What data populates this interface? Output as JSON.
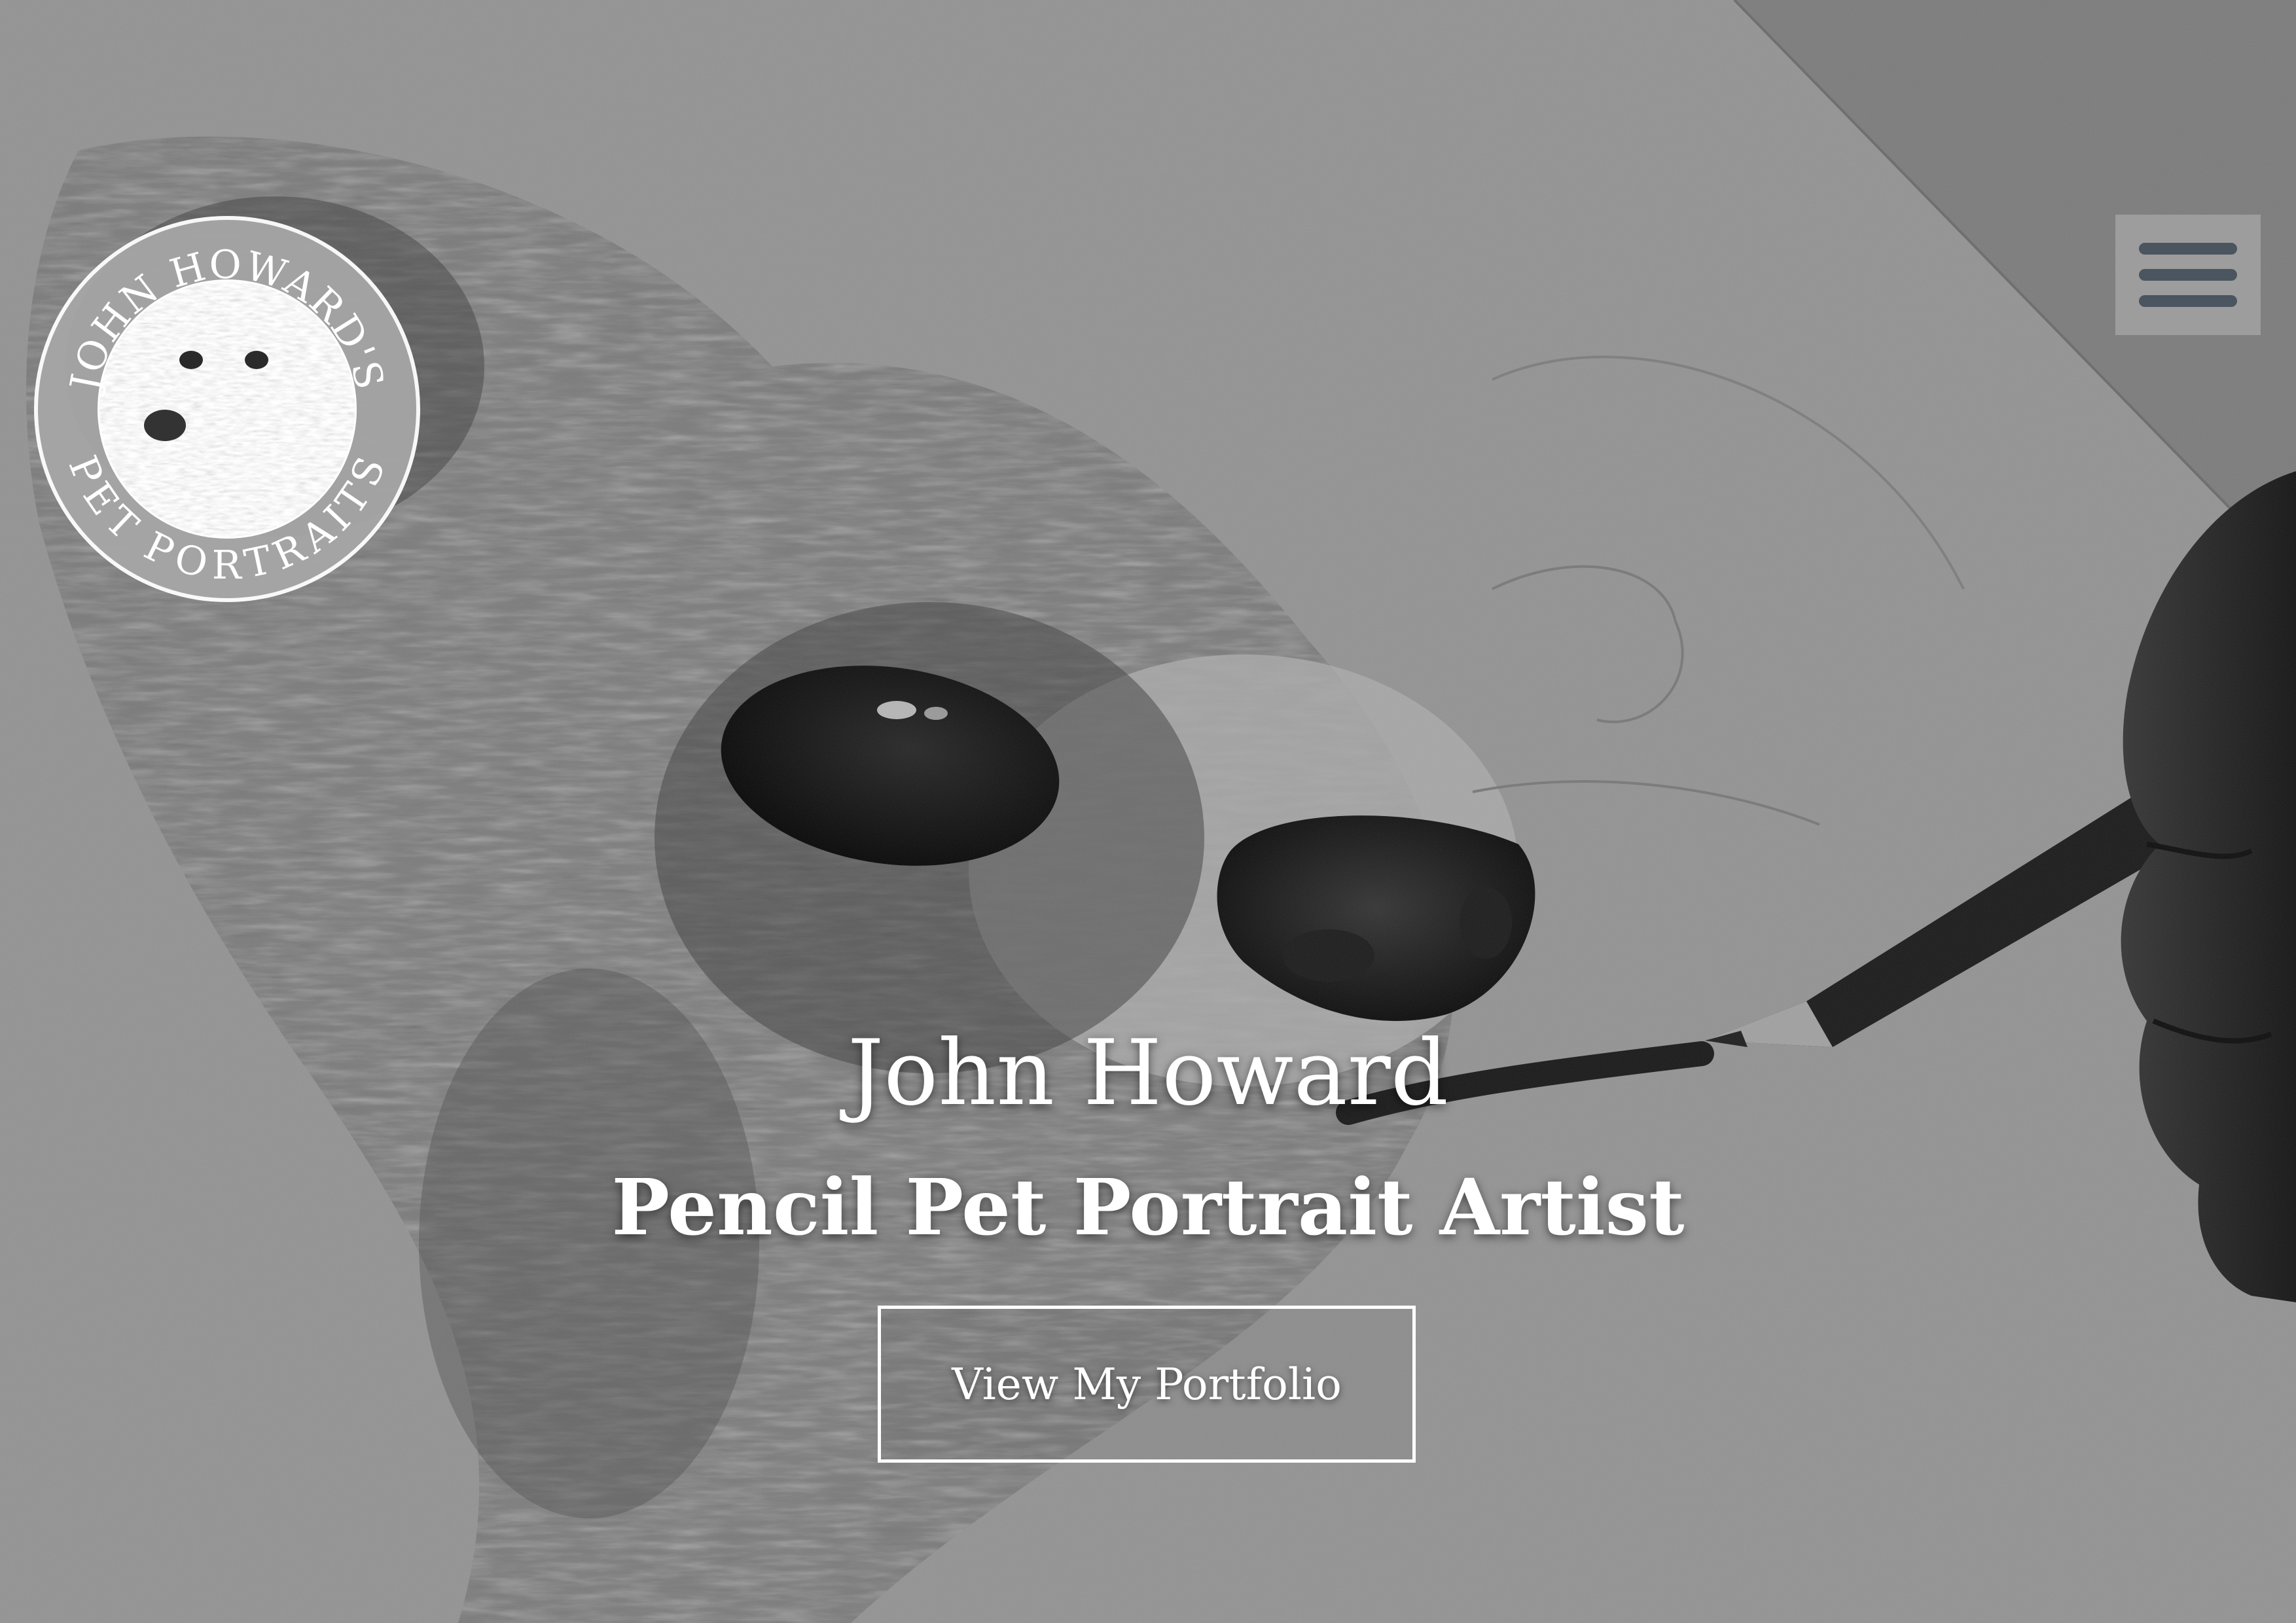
{
  "logo": {
    "arc_top": "JOHN HOWARD'S",
    "arc_bottom": "PET PORTRAITS"
  },
  "menu": {
    "icon": "hamburger-menu-icon"
  },
  "hero": {
    "title": "John Howard",
    "subtitle": "Pencil Pet Portrait Artist",
    "cta_label": "View My Portfolio",
    "background": "pencil-drawing-of-dog-with-hand-holding-pencil"
  },
  "colors": {
    "text": "#ffffff",
    "menu_bars": "#4b5560",
    "menu_bg": "#a0a0a0"
  }
}
